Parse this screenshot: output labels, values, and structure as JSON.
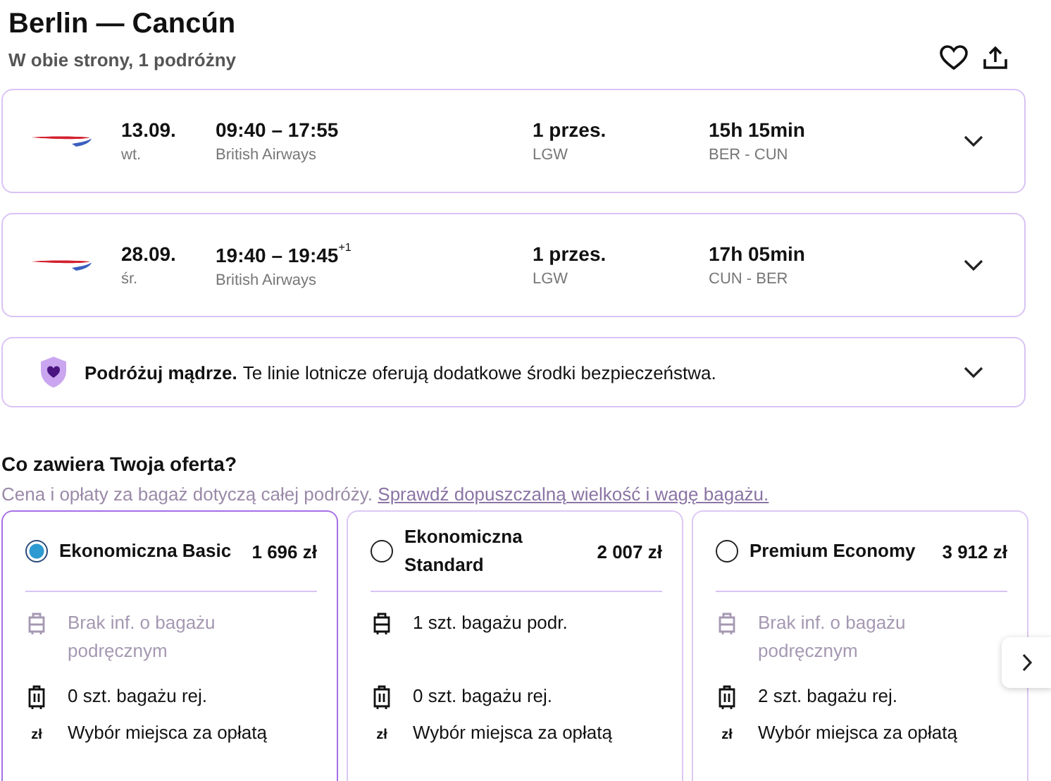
{
  "trip": {
    "title": "Berlin — Cancún",
    "subtitle": "W obie strony, 1 podróżny"
  },
  "flights": [
    {
      "date": "13.09.",
      "weekday": "wt.",
      "times": "09:40 – 17:55",
      "airline": "British Airways",
      "stops": "1 przes.",
      "via": "LGW",
      "duration": "15h 15min",
      "route": "BER - CUN"
    },
    {
      "date": "28.09.",
      "weekday": "śr.",
      "times": "19:40 – 19:45",
      "day_offset": "+1",
      "airline": "British Airways",
      "stops": "1 przes.",
      "via": "LGW",
      "duration": "17h 05min",
      "route": "CUN - BER"
    }
  ],
  "notice": {
    "bold": "Podróżuj mądrze.",
    "text": "Te linie lotnicze oferują dodatkowe środki bezpieczeństwa."
  },
  "offer": {
    "heading": "Co zawiera Twoja oferta?",
    "note": "Cena i opłaty za bagaż dotyczą całej podróży.",
    "link": "Sprawdź dopuszczalną wielkość i wagę bagażu."
  },
  "fares": [
    {
      "name": "Ekonomiczna Basic",
      "price": "1 696 zł",
      "selected": true,
      "features": [
        {
          "kind": "cabin",
          "text": "Brak inf. o bagażu podręcznym",
          "available": false
        },
        {
          "kind": "checked",
          "text": "0 szt. bagażu rej.",
          "available": true
        },
        {
          "kind": "seat",
          "symbol": "zł",
          "text": "Wybór miejsca za opłatą",
          "available": true
        }
      ]
    },
    {
      "name": "Ekonomiczna Standard",
      "price": "2 007 zł",
      "selected": false,
      "features": [
        {
          "kind": "cabin",
          "text": "1 szt. bagażu podr.",
          "available": true
        },
        {
          "kind": "checked",
          "text": "0 szt. bagażu rej.",
          "available": true
        },
        {
          "kind": "seat",
          "symbol": "zł",
          "text": "Wybór miejsca za opłatą",
          "available": true
        }
      ]
    },
    {
      "name": "Premium Economy",
      "price": "3 912 zł",
      "selected": false,
      "features": [
        {
          "kind": "cabin",
          "text": "Brak inf. o bagażu podręcznym",
          "available": false
        },
        {
          "kind": "checked",
          "text": "2 szt. bagażu rej.",
          "available": true
        },
        {
          "kind": "seat",
          "symbol": "zł",
          "text": "Wybór miejsca za opłatą",
          "available": true
        }
      ]
    }
  ]
}
